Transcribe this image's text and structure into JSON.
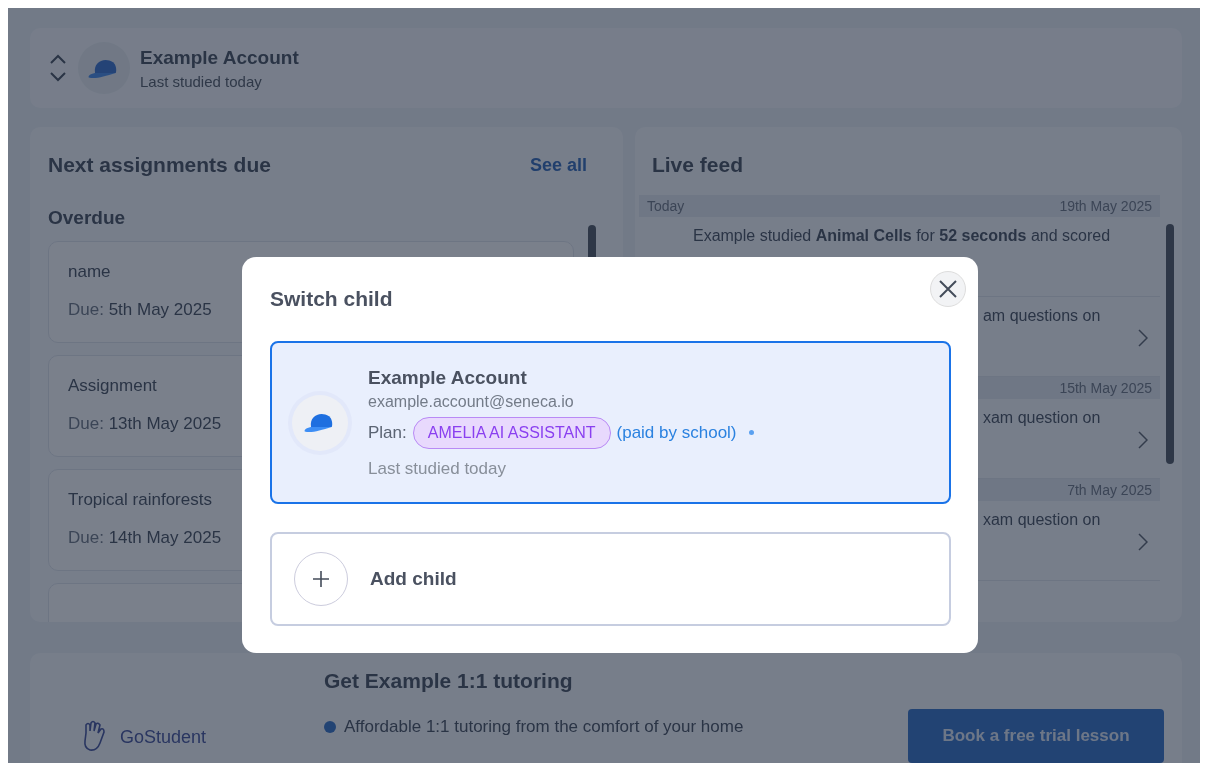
{
  "account_header": {
    "name": "Example Account",
    "status": "Last studied today"
  },
  "assignments": {
    "title": "Next assignments due",
    "see_all": "See all",
    "section": "Overdue",
    "items": [
      {
        "title": "name",
        "due_label": "Due:",
        "due_date": "5th May 2025"
      },
      {
        "title": "Assignment",
        "due_label": "Due:",
        "due_date": "13th May 2025"
      },
      {
        "title": "Tropical rainforests",
        "due_label": "Due:",
        "due_date": "14th May 2025"
      }
    ]
  },
  "live_feed": {
    "title": "Live feed",
    "groups": [
      {
        "day": "Today",
        "date": "19th May 2025",
        "items": [
          {
            "kind": "study",
            "text": "Example studied **Animal Cells** for **52 seconds** and scored"
          },
          {
            "kind": "exam",
            "text": "am questions on"
          }
        ]
      },
      {
        "date": "15th May 2025",
        "items": [
          {
            "kind": "exam",
            "text": "xam question on"
          }
        ]
      },
      {
        "date": "7th May 2025",
        "items": [
          {
            "kind": "exam",
            "text": "xam question on"
          }
        ]
      }
    ]
  },
  "tutoring": {
    "brand": "GoStudent",
    "title": "Get Example 1:1 tutoring",
    "bullets": [
      "Affordable 1:1 tutoring from the comfort of your home"
    ],
    "button": "Book a free trial lesson"
  },
  "modal": {
    "title": "Switch child",
    "children": [
      {
        "name": "Example Account",
        "email": "example.account@seneca.io",
        "plan_label": "Plan:",
        "plan": "AMELIA AI ASSISTANT",
        "plan_note": "(paid by school)",
        "status": "Last studied today",
        "selected": true
      }
    ],
    "add_label": "Add child"
  }
}
